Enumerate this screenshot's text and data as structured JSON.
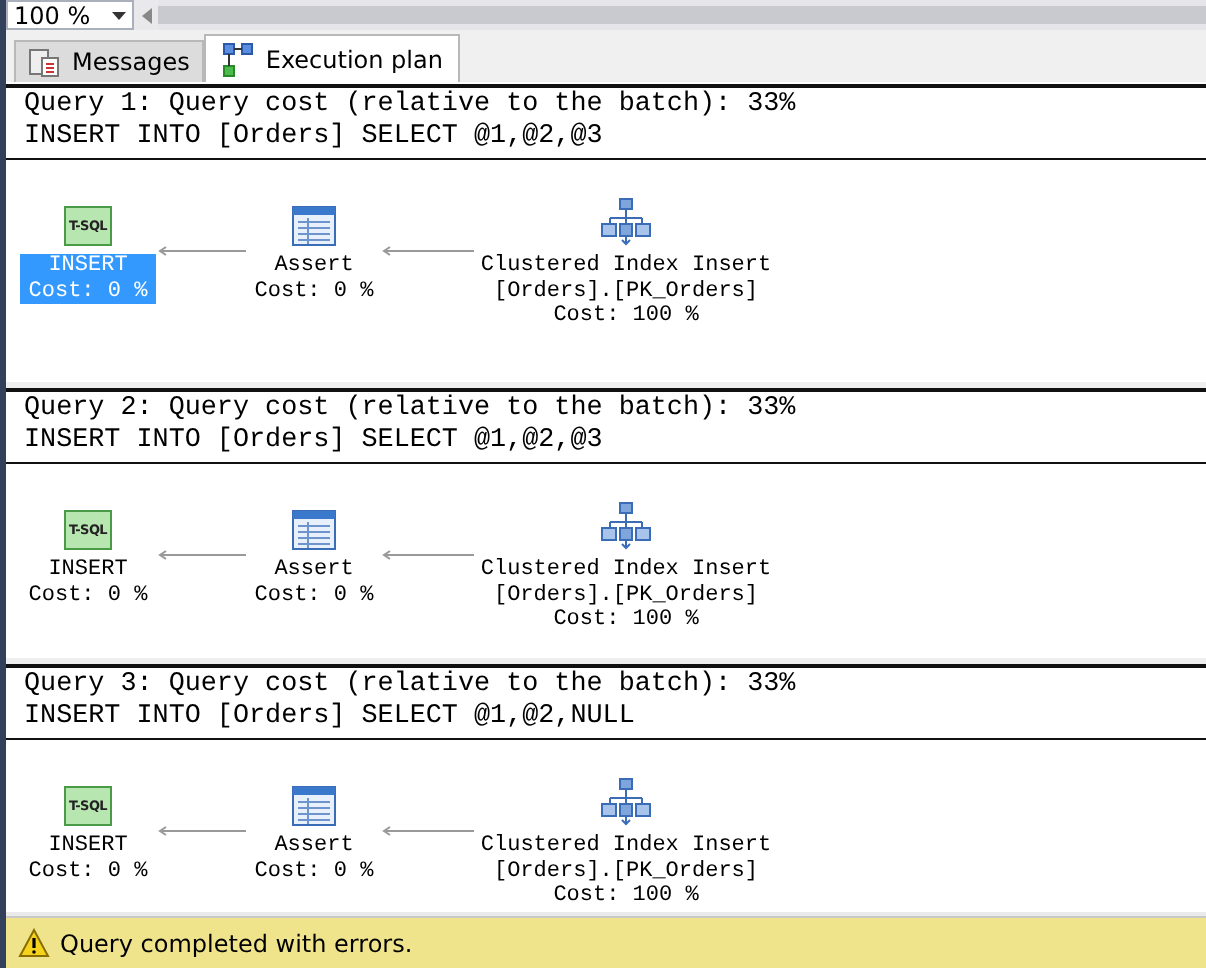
{
  "zoom": {
    "value": "100 %"
  },
  "tabs": [
    {
      "label": "Messages",
      "kind": "messages",
      "selected": false
    },
    {
      "label": "Execution plan",
      "kind": "plan",
      "selected": true
    }
  ],
  "queries": [
    {
      "header": "Query 1: Query cost (relative to the batch): 33%",
      "statement": "INSERT INTO [Orders] SELECT @1,@2,@3",
      "operators": [
        {
          "kind": "tsql",
          "icon_text": "T-SQL",
          "lines": [
            "INSERT",
            "Cost: 0 %"
          ],
          "selected": true
        },
        {
          "kind": "assert",
          "lines": [
            "Assert",
            "Cost: 0 %"
          ],
          "selected": false
        },
        {
          "kind": "index",
          "lines": [
            "Clustered Index Insert",
            "[Orders].[PK_Orders]",
            "Cost: 100 %"
          ],
          "selected": false
        }
      ]
    },
    {
      "header": "Query 2: Query cost (relative to the batch): 33%",
      "statement": "INSERT INTO [Orders] SELECT @1,@2,@3",
      "operators": [
        {
          "kind": "tsql",
          "icon_text": "T-SQL",
          "lines": [
            "INSERT",
            "Cost: 0 %"
          ],
          "selected": false
        },
        {
          "kind": "assert",
          "lines": [
            "Assert",
            "Cost: 0 %"
          ],
          "selected": false
        },
        {
          "kind": "index",
          "lines": [
            "Clustered Index Insert",
            "[Orders].[PK_Orders]",
            "Cost: 100 %"
          ],
          "selected": false
        }
      ]
    },
    {
      "header": "Query 3: Query cost (relative to the batch): 33%",
      "statement": "INSERT INTO [Orders] SELECT @1,@2,NULL",
      "operators": [
        {
          "kind": "tsql",
          "icon_text": "T-SQL",
          "lines": [
            "INSERT",
            "Cost: 0 %"
          ],
          "selected": false
        },
        {
          "kind": "assert",
          "lines": [
            "Assert",
            "Cost: 0 %"
          ],
          "selected": false
        },
        {
          "kind": "index",
          "lines": [
            "Clustered Index Insert",
            "[Orders].[PK_Orders]",
            "Cost: 100 %"
          ],
          "selected": false
        }
      ]
    }
  ],
  "status_bar": {
    "kind": "warning",
    "text": "Query completed with errors."
  }
}
